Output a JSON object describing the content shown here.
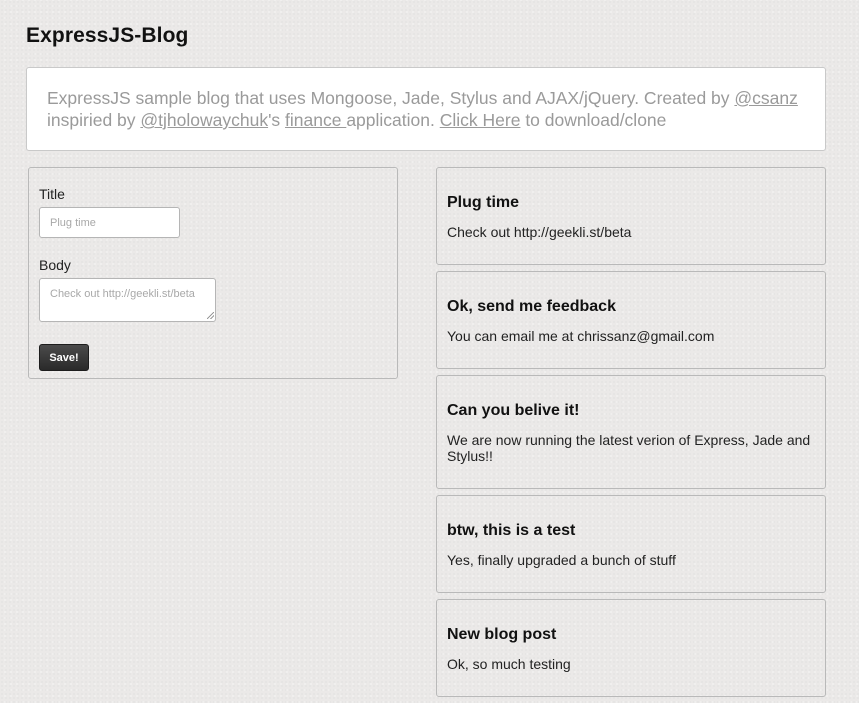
{
  "site": {
    "title": "ExpressJS-Blog"
  },
  "intro": {
    "text_1": "ExpressJS sample blog that uses Mongoose, Jade, Stylus and AJAX/jQuery. Created by ",
    "link_author": "@csanz ",
    "text_2": "inspiried by ",
    "link_inspiration": "@tjholowaychuk",
    "text_3": "'s ",
    "link_finance": "finance ",
    "text_4": "application. ",
    "link_download": "Click Here",
    "text_5": " to download/clone"
  },
  "form": {
    "title_label": "Title",
    "title_placeholder": "Plug time",
    "body_label": "Body",
    "body_placeholder": "Check out http://geekli.st/beta",
    "save_label": "Save!"
  },
  "posts": [
    {
      "title": "Plug time",
      "body": "Check out http://geekli.st/beta"
    },
    {
      "title": "Ok, send me feedback",
      "body": "You can email me at chrissanz@gmail.com"
    },
    {
      "title": "Can you belive it!",
      "body": "We are now running the latest verion of Express, Jade and Stylus!!"
    },
    {
      "title": "btw, this is a test",
      "body": "Yes, finally upgraded a bunch of stuff"
    },
    {
      "title": "New blog post",
      "body": "Ok, so much testing"
    }
  ]
}
